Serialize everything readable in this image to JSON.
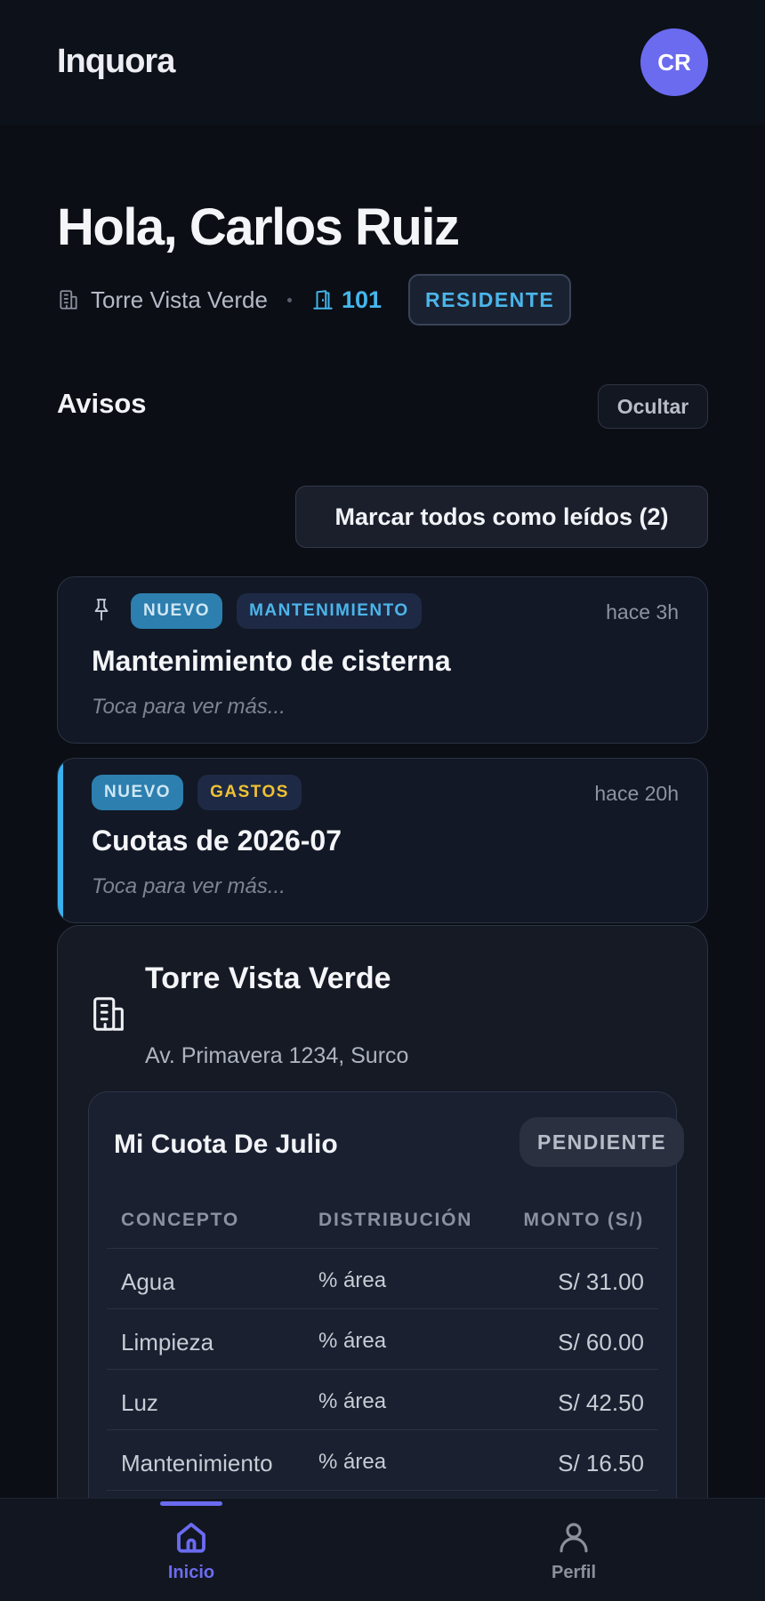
{
  "app": {
    "brand": "Inquora"
  },
  "user": {
    "initials": "CR",
    "greeting": "Hola, Carlos Ruiz"
  },
  "residence": {
    "building": "Torre Vista Verde",
    "unit": "101",
    "role": "RESIDENTE"
  },
  "notices": {
    "title": "Avisos",
    "hide_label": "Ocultar",
    "mark_all_label": "Marcar todos como leídos (2)",
    "items": [
      {
        "badge": "NUEVO",
        "category": "MANTENIMIENTO",
        "category_color": "#4cb5ea",
        "time": "hace 3h",
        "title": "Mantenimiento de cisterna",
        "hint": "Toca para ver más...",
        "pinned": true
      },
      {
        "badge": "NUEVO",
        "category": "GASTOS",
        "category_color": "#f0c132",
        "time": "hace 20h",
        "title": "Cuotas de 2026-07",
        "hint": "Toca para ver más...",
        "pinned": false
      }
    ]
  },
  "building_card": {
    "name": "Torre Vista Verde",
    "address": "Av. Primavera 1234, Surco",
    "fee": {
      "title": "Mi Cuota De Julio",
      "status": "PENDIENTE",
      "columns": [
        "CONCEPTO",
        "DISTRIBUCIÓN",
        "MONTO (S/)"
      ],
      "rows": [
        {
          "concept": "Agua",
          "distribution": "% área",
          "amount": "S/ 31.00"
        },
        {
          "concept": "Limpieza",
          "distribution": "% área",
          "amount": "S/ 60.00"
        },
        {
          "concept": "Luz",
          "distribution": "% área",
          "amount": "S/ 42.50"
        },
        {
          "concept": "Mantenimiento",
          "distribution": "% área",
          "amount": "S/ 16.50"
        }
      ]
    }
  },
  "nav": {
    "items": [
      {
        "label": "Inicio",
        "icon": "home-icon",
        "active": true
      },
      {
        "label": "Perfil",
        "icon": "user-icon",
        "active": false
      }
    ]
  },
  "colors": {
    "accent": "#6b6bf0",
    "info": "#45b6ec",
    "warning": "#f0c132",
    "background": "#0b0e15"
  }
}
